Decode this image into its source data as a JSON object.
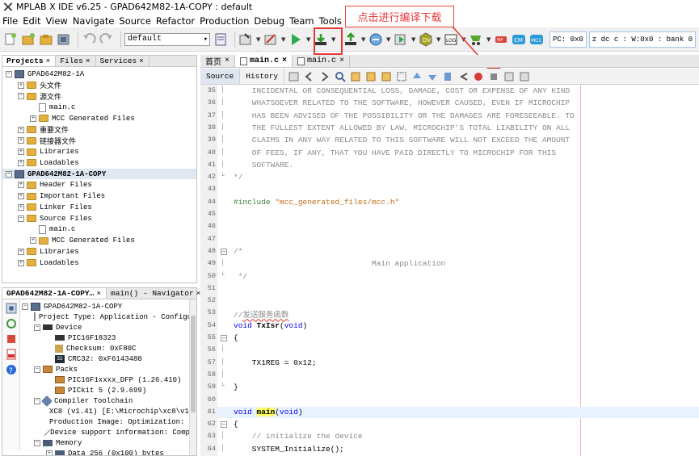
{
  "window": {
    "title": "MPLAB X IDE v6.25 - GPAD642M82-1A-COPY : default"
  },
  "menu": [
    "File",
    "Edit",
    "View",
    "Navigate",
    "Source",
    "Refactor",
    "Production",
    "Debug",
    "Team",
    "Tools",
    "Window",
    "Help"
  ],
  "toolbar": {
    "config_value": "default",
    "pc_status": "PC: 0x0",
    "reg_status": "z dc c  : W:0x0 : bank 0",
    "icons": [
      "new-file-icon",
      "new-project-icon",
      "open-project-icon",
      "close-project-icon",
      "undo-icon",
      "redo-icon",
      "project-properties-icon",
      "build-icon",
      "clean-build-icon",
      "run-icon",
      "make-program-device-icon",
      "read-device-icon",
      "debug-icon",
      "step-icon",
      "data-visualizer-icon",
      "log-icon",
      "plugins-icon",
      "halt-icon",
      "mcc-cm-icon",
      "mcc-icon"
    ]
  },
  "annotation": {
    "text": "点击进行编译下载",
    "badge": "1"
  },
  "projects_panel": {
    "tabs": [
      "Projects",
      "Files",
      "Services"
    ],
    "tree": [
      {
        "label": "GPAD642M82-1A",
        "indent": 0,
        "icon": "project-icon",
        "expanded": true,
        "bold": false
      },
      {
        "label": "头文件",
        "indent": 1,
        "icon": "folder-icon",
        "expanded": false
      },
      {
        "label": "源文件",
        "indent": 1,
        "icon": "folder-icon",
        "expanded": true
      },
      {
        "label": "main.c",
        "indent": 2,
        "icon": "c-file-icon"
      },
      {
        "label": "MCC Generated Files",
        "indent": 2,
        "icon": "folder-icon",
        "expanded": false
      },
      {
        "label": "重要文件",
        "indent": 1,
        "icon": "folder-icon",
        "expanded": false
      },
      {
        "label": "链接器文件",
        "indent": 1,
        "icon": "folder-icon",
        "expanded": false
      },
      {
        "label": "Libraries",
        "indent": 1,
        "icon": "folder-icon",
        "expanded": false
      },
      {
        "label": "Loadables",
        "indent": 1,
        "icon": "folder-icon",
        "expanded": false
      },
      {
        "label": "GPAD642M82-1A-COPY",
        "indent": 0,
        "icon": "project-icon",
        "expanded": true,
        "bold": true
      },
      {
        "label": "Header Files",
        "indent": 1,
        "icon": "folder-icon",
        "expanded": false
      },
      {
        "label": "Important Files",
        "indent": 1,
        "icon": "folder-icon",
        "expanded": false
      },
      {
        "label": "Linker Files",
        "indent": 1,
        "icon": "folder-icon",
        "expanded": false
      },
      {
        "label": "Source Files",
        "indent": 1,
        "icon": "folder-icon",
        "expanded": true
      },
      {
        "label": "main.c",
        "indent": 2,
        "icon": "c-file-icon"
      },
      {
        "label": "MCC Generated Files",
        "indent": 2,
        "icon": "folder-icon",
        "expanded": false
      },
      {
        "label": "Libraries",
        "indent": 1,
        "icon": "folder-icon",
        "expanded": false
      },
      {
        "label": "Loadables",
        "indent": 1,
        "icon": "folder-icon",
        "expanded": false
      }
    ]
  },
  "dashboard_panel": {
    "tabs": [
      "GPAD642M82-1A-COPY…",
      "main() - Navigator"
    ],
    "tree": [
      {
        "label": "GPAD642M82-1A-COPY",
        "indent": 0,
        "icon": "project-icon",
        "exp": "-"
      },
      {
        "label": "Project Type: Application - Configura",
        "indent": 1,
        "icon": "file-icon"
      },
      {
        "label": "Device",
        "indent": 1,
        "icon": "chip-icon",
        "exp": "-"
      },
      {
        "label": "PIC16F18323",
        "indent": 2,
        "icon": "chip-icon"
      },
      {
        "label": "Checksum: 0xF80C",
        "indent": 2,
        "icon": "checksum-icon"
      },
      {
        "label": "CRC32: 0xF6143480",
        "indent": 2,
        "icon": "crc32-icon"
      },
      {
        "label": "Packs",
        "indent": 1,
        "icon": "pack-icon",
        "exp": "-"
      },
      {
        "label": "PIC16F1xxxx_DFP (1.26.410)",
        "indent": 2,
        "icon": "pack-icon"
      },
      {
        "label": "PICkit 5 (2.9.699)",
        "indent": 2,
        "icon": "pack-icon"
      },
      {
        "label": "Compiler Toolchain",
        "indent": 1,
        "icon": "toolchain-icon",
        "exp": "-"
      },
      {
        "label": "XC8 (v1.41) [E:\\Microchip\\xc8\\v1.4",
        "indent": 2,
        "icon": "toolchain-icon"
      },
      {
        "label": "Production Image: Optimization: +",
        "indent": 2,
        "icon": "toolchain-icon"
      },
      {
        "label": "Device support information: Comp",
        "indent": 2,
        "icon": "toolchain-icon"
      },
      {
        "label": "Memory",
        "indent": 1,
        "icon": "memory-icon",
        "exp": "-"
      },
      {
        "label": "Data 256 (0x100) bytes",
        "indent": 2,
        "icon": "memory-icon",
        "exp": "+"
      }
    ]
  },
  "editor": {
    "tabs": [
      {
        "label": "首页",
        "active": false
      },
      {
        "label": "main.c",
        "active": true
      },
      {
        "label": "main.c",
        "active": false
      }
    ],
    "source_tabs": [
      "Source",
      "History"
    ],
    "lines": [
      {
        "n": "35",
        "text": "    INCIDENTAL OR CONSEQUENTIAL LOSS, DAMAGE, COST OR EXPENSE OF ANY KIND",
        "cls": "cmt"
      },
      {
        "n": "36",
        "text": "    WHATSOEVER RELATED TO THE SOFTWARE, HOWEVER CAUSED, EVEN IF MICROCHIP",
        "cls": "cmt"
      },
      {
        "n": "37",
        "text": "    HAS BEEN ADVISED OF THE POSSIBILITY OR THE DAMAGES ARE FORESEEABLE. TO",
        "cls": "cmt"
      },
      {
        "n": "38",
        "text": "    THE FULLEST EXTENT ALLOWED BY LAW, MICROCHIP'S TOTAL LIABILITY ON ALL",
        "cls": "cmt"
      },
      {
        "n": "39",
        "text": "    CLAIMS IN ANY WAY RELATED TO THIS SOFTWARE WILL NOT EXCEED THE AMOUNT",
        "cls": "cmt"
      },
      {
        "n": "40",
        "text": "    OF FEES, IF ANY, THAT YOU HAVE PAID DIRECTLY TO MICROCHIP FOR THIS",
        "cls": "cmt"
      },
      {
        "n": "41",
        "text": "    SOFTWARE.",
        "cls": "cmt"
      },
      {
        "n": "42",
        "text": "*/",
        "cls": "cmt"
      },
      {
        "n": "43",
        "text": "",
        "cls": ""
      },
      {
        "n": "44",
        "text": "#include \"mcc_generated_files/mcc.h\"",
        "cls": "pre"
      },
      {
        "n": "45",
        "text": "",
        "cls": ""
      },
      {
        "n": "46",
        "text": "",
        "cls": ""
      },
      {
        "n": "47",
        "text": "",
        "cls": ""
      },
      {
        "n": "48",
        "text": "/*",
        "cls": "cmt"
      },
      {
        "n": "49",
        "text": "                              Main application",
        "cls": "cmt"
      },
      {
        "n": "50",
        "text": " */",
        "cls": "cmt"
      },
      {
        "n": "51",
        "text": "",
        "cls": ""
      },
      {
        "n": "52",
        "text": "",
        "cls": ""
      },
      {
        "n": "53",
        "text": "//发送服务函数",
        "cls": "cmt"
      },
      {
        "n": "54",
        "text": "void TxIsr(void)",
        "cls": ""
      },
      {
        "n": "55",
        "text": "{",
        "cls": ""
      },
      {
        "n": "56",
        "text": "",
        "cls": ""
      },
      {
        "n": "57",
        "text": "    TX1REG = 0x12;",
        "cls": ""
      },
      {
        "n": "58",
        "text": "",
        "cls": ""
      },
      {
        "n": "59",
        "text": "}",
        "cls": ""
      },
      {
        "n": "60",
        "text": "",
        "cls": ""
      },
      {
        "n": "61",
        "text": "void main(void)",
        "cls": ""
      },
      {
        "n": "62",
        "text": "{",
        "cls": ""
      },
      {
        "n": "63",
        "text": "    // initialize the device",
        "cls": "cmt"
      },
      {
        "n": "64",
        "text": "    SYSTEM_Initialize();",
        "cls": ""
      }
    ]
  },
  "colors": {
    "annotation_red": "#e53935",
    "comment_gray": "#8a8a8a",
    "keyword_blue": "#0000e6",
    "string_orange": "#c06d1a",
    "preprocessor_green": "#3b7a3b"
  }
}
